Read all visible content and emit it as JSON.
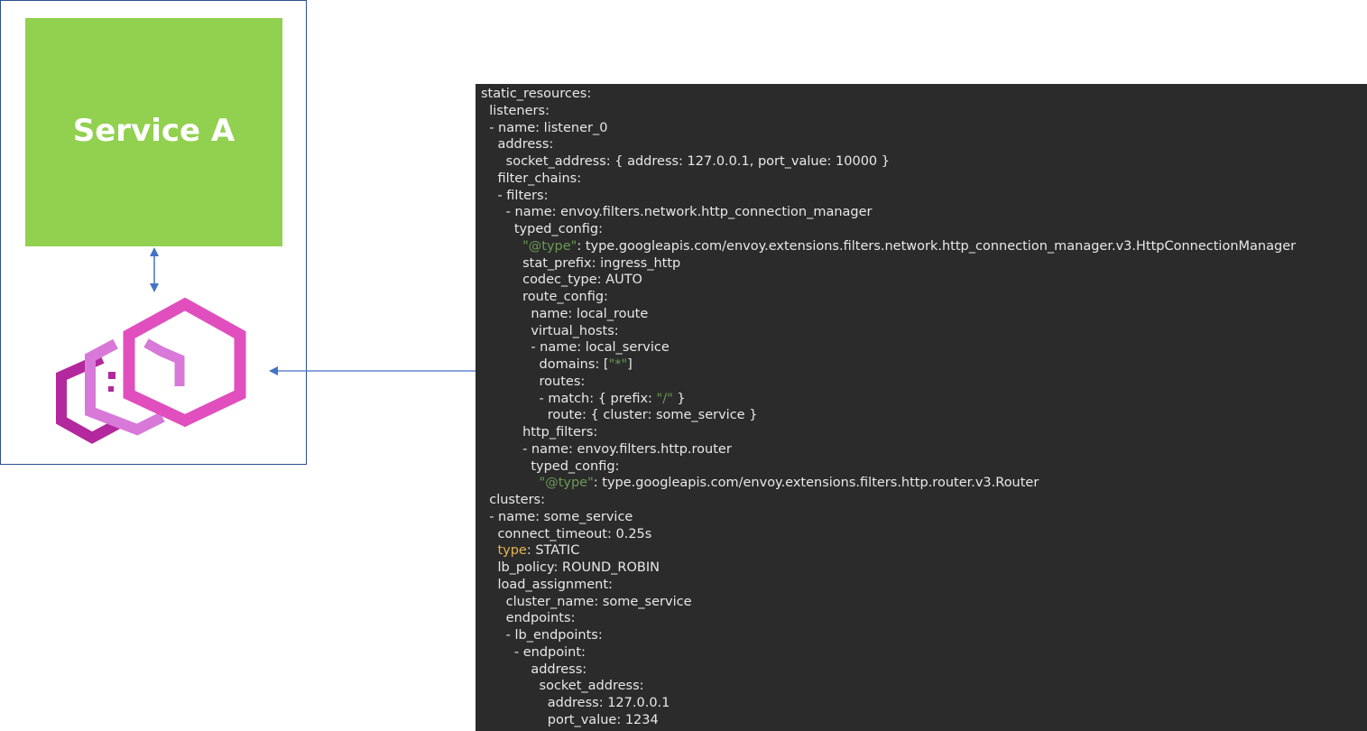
{
  "diagram": {
    "service_label": "Service A",
    "colors": {
      "service_box": "#92d050",
      "pod_border": "#2f4f8f",
      "arrow": "#4472c4",
      "code_background": "#2b2b2b",
      "envoy_magenta": "#e04fbd",
      "envoy_purple": "#b3289c",
      "envoy_light": "#d879d9"
    },
    "icons": {
      "proxy": "envoy-logo-icon"
    }
  },
  "code": {
    "language": "yaml",
    "lines": [
      {
        "indent": "",
        "tokens": [
          {
            "t": "static_resources:",
            "c": "key"
          }
        ]
      },
      {
        "indent": "  ",
        "tokens": [
          {
            "t": "listeners:",
            "c": "key"
          }
        ]
      },
      {
        "indent": "  ",
        "tokens": [
          {
            "t": "- name: listener_0",
            "c": "key"
          }
        ]
      },
      {
        "indent": "    ",
        "tokens": [
          {
            "t": "address:",
            "c": "key"
          }
        ]
      },
      {
        "indent": "      ",
        "tokens": [
          {
            "t": "socket_address: { address: 127.0.0.1, port_value: 10000 }",
            "c": "key"
          }
        ]
      },
      {
        "indent": "    ",
        "tokens": [
          {
            "t": "filter_chains:",
            "c": "key"
          }
        ]
      },
      {
        "indent": "    ",
        "tokens": [
          {
            "t": "- filters:",
            "c": "key"
          }
        ]
      },
      {
        "indent": "      ",
        "tokens": [
          {
            "t": "- name: envoy.filters.network.http_connection_manager",
            "c": "key"
          }
        ]
      },
      {
        "indent": "        ",
        "tokens": [
          {
            "t": "typed_config:",
            "c": "key"
          }
        ]
      },
      {
        "indent": "          ",
        "tokens": [
          {
            "t": "\"@type\"",
            "c": "string"
          },
          {
            "t": ": type.googleapis.com/envoy.extensions.filters.network.http_connection_manager.v3.HttpConnectionManager",
            "c": "key"
          }
        ]
      },
      {
        "indent": "          ",
        "tokens": [
          {
            "t": "stat_prefix: ingress_http",
            "c": "key"
          }
        ]
      },
      {
        "indent": "          ",
        "tokens": [
          {
            "t": "codec_type: AUTO",
            "c": "key"
          }
        ]
      },
      {
        "indent": "          ",
        "tokens": [
          {
            "t": "route_config:",
            "c": "key"
          }
        ]
      },
      {
        "indent": "            ",
        "tokens": [
          {
            "t": "name: local_route",
            "c": "key"
          }
        ]
      },
      {
        "indent": "            ",
        "tokens": [
          {
            "t": "virtual_hosts:",
            "c": "key"
          }
        ]
      },
      {
        "indent": "            ",
        "tokens": [
          {
            "t": "- name: local_service",
            "c": "key"
          }
        ]
      },
      {
        "indent": "              ",
        "tokens": [
          {
            "t": "domains: [",
            "c": "key"
          },
          {
            "t": "\"*\"",
            "c": "string"
          },
          {
            "t": "]",
            "c": "key"
          }
        ]
      },
      {
        "indent": "              ",
        "tokens": [
          {
            "t": "routes:",
            "c": "key"
          }
        ]
      },
      {
        "indent": "              ",
        "tokens": [
          {
            "t": "- match: { prefix: ",
            "c": "key"
          },
          {
            "t": "\"/\"",
            "c": "string"
          },
          {
            "t": " }",
            "c": "key"
          }
        ]
      },
      {
        "indent": "                ",
        "tokens": [
          {
            "t": "route: { cluster: some_service }",
            "c": "key"
          }
        ]
      },
      {
        "indent": "          ",
        "tokens": [
          {
            "t": "http_filters:",
            "c": "key"
          }
        ]
      },
      {
        "indent": "          ",
        "tokens": [
          {
            "t": "- name: envoy.filters.http.router",
            "c": "key"
          }
        ]
      },
      {
        "indent": "            ",
        "tokens": [
          {
            "t": "typed_config:",
            "c": "key"
          }
        ]
      },
      {
        "indent": "              ",
        "tokens": [
          {
            "t": "\"@type\"",
            "c": "string"
          },
          {
            "t": ": type.googleapis.com/envoy.extensions.filters.http.router.v3.Router",
            "c": "key"
          }
        ]
      },
      {
        "indent": "  ",
        "tokens": [
          {
            "t": "clusters:",
            "c": "key"
          }
        ]
      },
      {
        "indent": "  ",
        "tokens": [
          {
            "t": "- name: some_service",
            "c": "key"
          }
        ]
      },
      {
        "indent": "    ",
        "tokens": [
          {
            "t": "connect_timeout: 0.25s",
            "c": "key"
          }
        ]
      },
      {
        "indent": "    ",
        "tokens": [
          {
            "t": "type",
            "c": "keyword"
          },
          {
            "t": ": STATIC",
            "c": "key"
          }
        ]
      },
      {
        "indent": "    ",
        "tokens": [
          {
            "t": "lb_policy: ROUND_ROBIN",
            "c": "key"
          }
        ]
      },
      {
        "indent": "    ",
        "tokens": [
          {
            "t": "load_assignment:",
            "c": "key"
          }
        ]
      },
      {
        "indent": "      ",
        "tokens": [
          {
            "t": "cluster_name: some_service",
            "c": "key"
          }
        ]
      },
      {
        "indent": "      ",
        "tokens": [
          {
            "t": "endpoints:",
            "c": "key"
          }
        ]
      },
      {
        "indent": "      ",
        "tokens": [
          {
            "t": "- lb_endpoints:",
            "c": "key"
          }
        ]
      },
      {
        "indent": "        ",
        "tokens": [
          {
            "t": "- endpoint:",
            "c": "key"
          }
        ]
      },
      {
        "indent": "            ",
        "tokens": [
          {
            "t": "address:",
            "c": "key"
          }
        ]
      },
      {
        "indent": "              ",
        "tokens": [
          {
            "t": "socket_address:",
            "c": "key"
          }
        ]
      },
      {
        "indent": "                ",
        "tokens": [
          {
            "t": "address: 127.0.0.1",
            "c": "key"
          }
        ]
      },
      {
        "indent": "                ",
        "tokens": [
          {
            "t": "port_value: 1234",
            "c": "key"
          }
        ]
      }
    ]
  }
}
